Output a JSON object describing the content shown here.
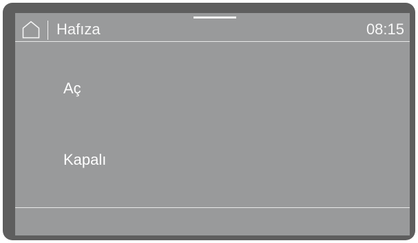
{
  "header": {
    "home_icon": "home-icon",
    "title": "Hafıza",
    "time": "08:15"
  },
  "options": [
    {
      "label": "Aç"
    },
    {
      "label": "Kapalı"
    }
  ],
  "colors": {
    "bezel": "#5e5e5e",
    "screen": "#999a9b",
    "text": "#ffffff"
  }
}
